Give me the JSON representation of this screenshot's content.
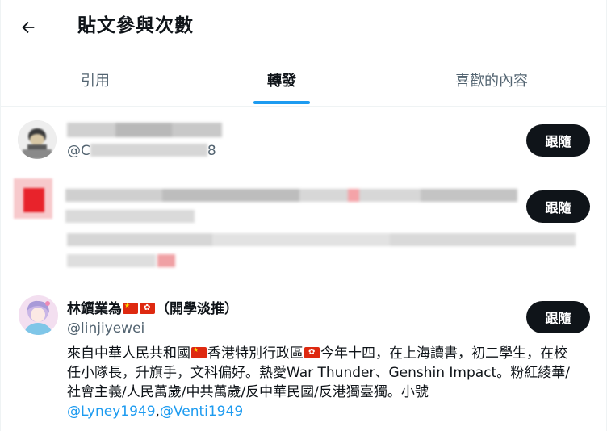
{
  "header": {
    "title": "貼文參與次數",
    "back_icon": "arrow-left-icon"
  },
  "tabs": [
    {
      "label": "引用",
      "active": false
    },
    {
      "label": "轉發",
      "active": true
    },
    {
      "label": "喜歡的內容",
      "active": false
    }
  ],
  "users": [
    {
      "name": "",
      "handle_prefix": "@C",
      "handle_suffix": "8",
      "follow_label": "跟隨",
      "blurred": true
    },
    {
      "name": "",
      "handle": "",
      "follow_label": "跟隨",
      "blurred": true
    },
    {
      "name": "林鑕業為",
      "name_suffix": "（開學淡推）",
      "handle": "@linjiyewei",
      "follow_label": "跟隨",
      "bio": {
        "part1": "來自中華人民共和國",
        "part2": "香港特別行政區",
        "part3": "今年十四，在上海讀書，初二學生，在校任小隊長，升旗手，文科偏好。熱愛War Thunder、Genshin Impact。粉紅綾華/社會主義/人民萬歲/中共萬歲/反中華民國/反港獨臺獨。小號",
        "link1": "@Lyney1949",
        "sep": ",",
        "link2": "@Venti1949"
      }
    }
  ],
  "colors": {
    "accent": "#1d9bf0",
    "button_bg": "#0f1419",
    "secondary_text": "#536471"
  }
}
